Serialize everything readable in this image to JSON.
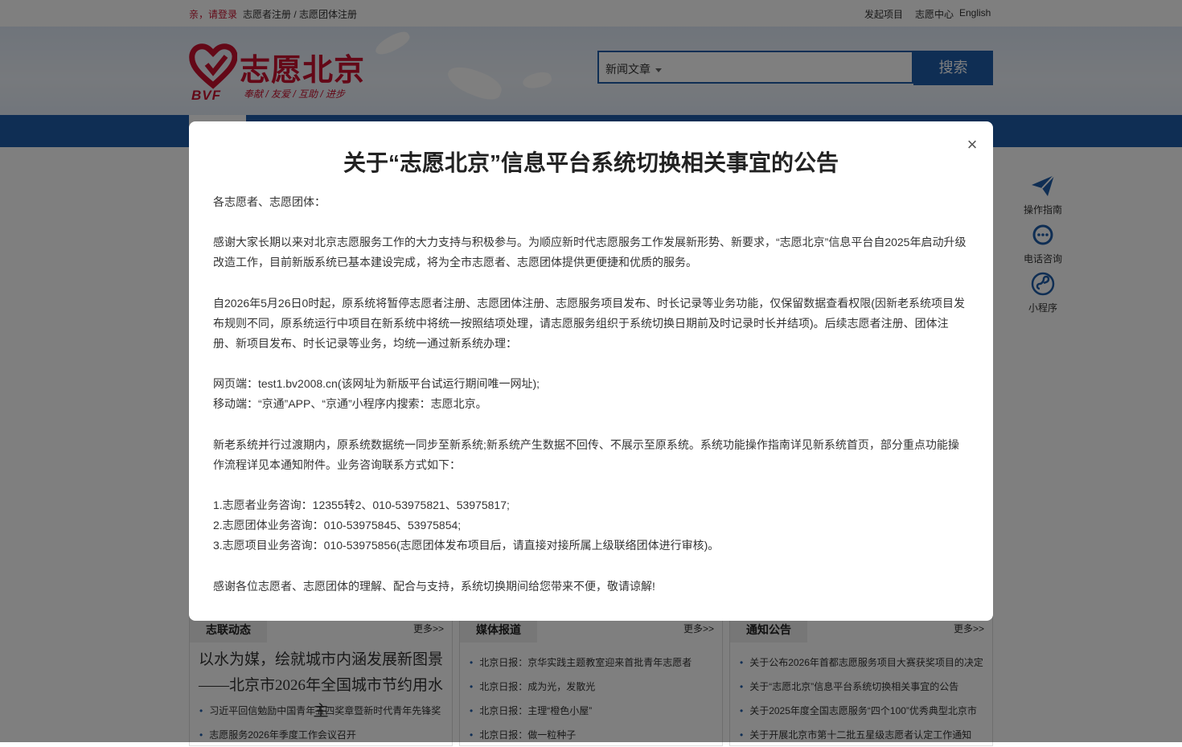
{
  "topbar": {
    "login": "亲，请登录",
    "register": "志愿者注册 / 志愿团体注册",
    "links": [
      "发起项目",
      "志愿中心",
      "English"
    ]
  },
  "logo": {
    "name": "志愿北京",
    "abbr": "BVF",
    "slogan": "奉献 / 友爱 / 互助 / 进步"
  },
  "search": {
    "category": "新闻文章",
    "button": "搜索"
  },
  "side": [
    "操作指南",
    "电话咨询",
    "小程序"
  ],
  "columns": [
    {
      "tab": "志联动态",
      "more": "更多>>",
      "headline": "以水为媒，绘就城市内涵发展新图景——北京市2026年全国城市节约用水主",
      "items": [
        "习近平回信勉励中国青年五四奖章暨新时代青年先锋奖",
        "志愿服务2026年季度工作会议召开"
      ]
    },
    {
      "tab": "媒体报道",
      "more": "更多>>",
      "items": [
        "北京日报：京华实践主题教室迎来首批青年志愿者",
        "北京日报：成为光，发散光",
        "北京日报：主理“橙色小屋”",
        "北京日报：做一粒种子"
      ]
    },
    {
      "tab": "通知公告",
      "more": "更多>>",
      "items": [
        "关于公布2026年首都志愿服务项目大赛获奖项目的决定",
        "关于“志愿北京”信息平台系统切换相关事宜的公告",
        "关于2025年度全国志愿服务“四个100”优秀典型北京市",
        "关于开展北京市第十二批五星级志愿者认定工作通知"
      ]
    }
  ],
  "modal": {
    "title": "关于“志愿北京”信息平台系统切换相关事宜的公告",
    "close": "×",
    "paragraphs": [
      [
        "各志愿者、志愿团体："
      ],
      [
        "感谢大家长期以来对北京志愿服务工作的大力支持与积极参与。为顺应新时代志愿服务工作发展新形势、新要求，“志愿北京”信息平台自2025年启动升级改造工作，目前新版系统已基本建设完成，将为全市志愿者、志愿团体提供更便捷和优质的服务。"
      ],
      [
        "自2026年5月26日0时起，原系统将暂停志愿者注册、志愿团体注册、志愿服务项目发布、时长记录等业务功能，仅保留数据查看权限(因新老系统项目发布规则不同，原系统运行中项目在新系统中将统一按照结项处理，请志愿服务组织于系统切换日期前及时记录时长并结项)。后续志愿者注册、团体注册、新项目发布、时长记录等业务，均统一通过新系统办理："
      ],
      [
        "网页端：test1.bv2008.cn(该网址为新版平台试运行期间唯一网址);",
        "移动端：“京通”APP、“京通”小程序内搜索：志愿北京。"
      ],
      [
        "新老系统并行过渡期内，原系统数据统一同步至新系统;新系统产生数据不回传、不展示至原系统。系统功能操作指南详见新系统首页，部分重点功能操作流程详见本通知附件。业务咨询联系方式如下："
      ],
      [
        "1.志愿者业务咨询：12355转2、010-53975821、53975817;",
        "2.志愿团体业务咨询：010-53975845、53975854;",
        "3.志愿项目业务咨询：010-53975856(志愿团体发布项目后，请直接对接所属上级联络团体进行审核)。"
      ],
      [
        "感谢各位志愿者、志愿团体的理解、配合与支持，系统切换期间给您带来不便，敬请谅解!"
      ]
    ]
  },
  "colors": {
    "brand_red": "#c8102e",
    "brand_blue": "#1f5ca8"
  }
}
